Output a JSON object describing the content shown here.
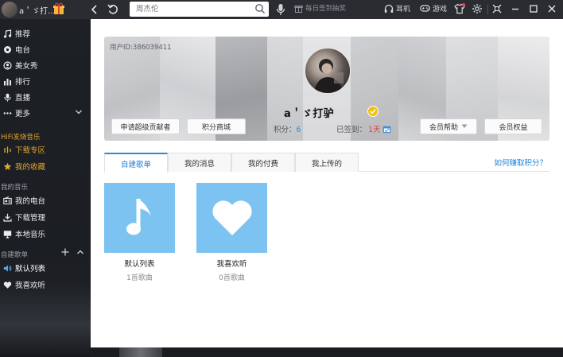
{
  "topbar": {
    "username": "a＇ゞ打...",
    "search_placeholder": "周杰伦",
    "signin_label": "每日签到抽奖",
    "earphone_label": "耳机",
    "game_label": "游戏"
  },
  "sidebar": {
    "items": [
      {
        "label": "推荐",
        "icon": "music-note-icon"
      },
      {
        "label": "电台",
        "icon": "radio-icon"
      },
      {
        "label": "美女秀",
        "icon": "beauty-show-icon"
      },
      {
        "label": "排行",
        "icon": "chart-icon"
      },
      {
        "label": "直播",
        "icon": "microphone-icon"
      },
      {
        "label": "更多",
        "icon": "more-icon"
      }
    ],
    "hifi_title": "HiFi发烧音乐",
    "hifi_items": [
      {
        "label": "下载专区",
        "icon": "equalizer-icon"
      },
      {
        "label": "我的收藏",
        "icon": "star-icon"
      }
    ],
    "my_music_title": "我的音乐",
    "my_music_items": [
      {
        "label": "我的电台",
        "icon": "radio-box-icon"
      },
      {
        "label": "下载管理",
        "icon": "download-icon"
      },
      {
        "label": "本地音乐",
        "icon": "monitor-icon"
      }
    ],
    "playlist_title": "自建歌单",
    "playlist_items": [
      {
        "label": "默认列表",
        "icon": "speaker-icon"
      },
      {
        "label": "我喜欢听",
        "icon": "heart-icon"
      }
    ]
  },
  "profile": {
    "user_id": "用户ID:386039411",
    "nickname": "a＇ゞ打驴",
    "points_label": "积分：",
    "points_value": "6",
    "signed_label": "已签到：",
    "signed_value": "1天",
    "contributor_button": "申请超级贡献者",
    "mall_button": "积分商城",
    "vip_help_button": "会员帮助",
    "vip_rights_button": "会员权益"
  },
  "tabs": [
    {
      "label": "自建歌单",
      "active": true
    },
    {
      "label": "我的消息",
      "active": false
    },
    {
      "label": "我的付费",
      "active": false
    },
    {
      "label": "我上传的",
      "active": false
    }
  ],
  "earn_points_link": "如何赚取积分？",
  "playlists": [
    {
      "name": "默认列表",
      "count": "1首歌曲",
      "icon": "music-note-icon"
    },
    {
      "name": "我喜欢听",
      "count": "0首歌曲",
      "icon": "heart-icon"
    }
  ],
  "colors": {
    "accent_blue": "#2b8ad6",
    "gold": "#e3a533",
    "cover_blue": "#7cc3f2",
    "sidebar_bg": "#1d2025"
  }
}
